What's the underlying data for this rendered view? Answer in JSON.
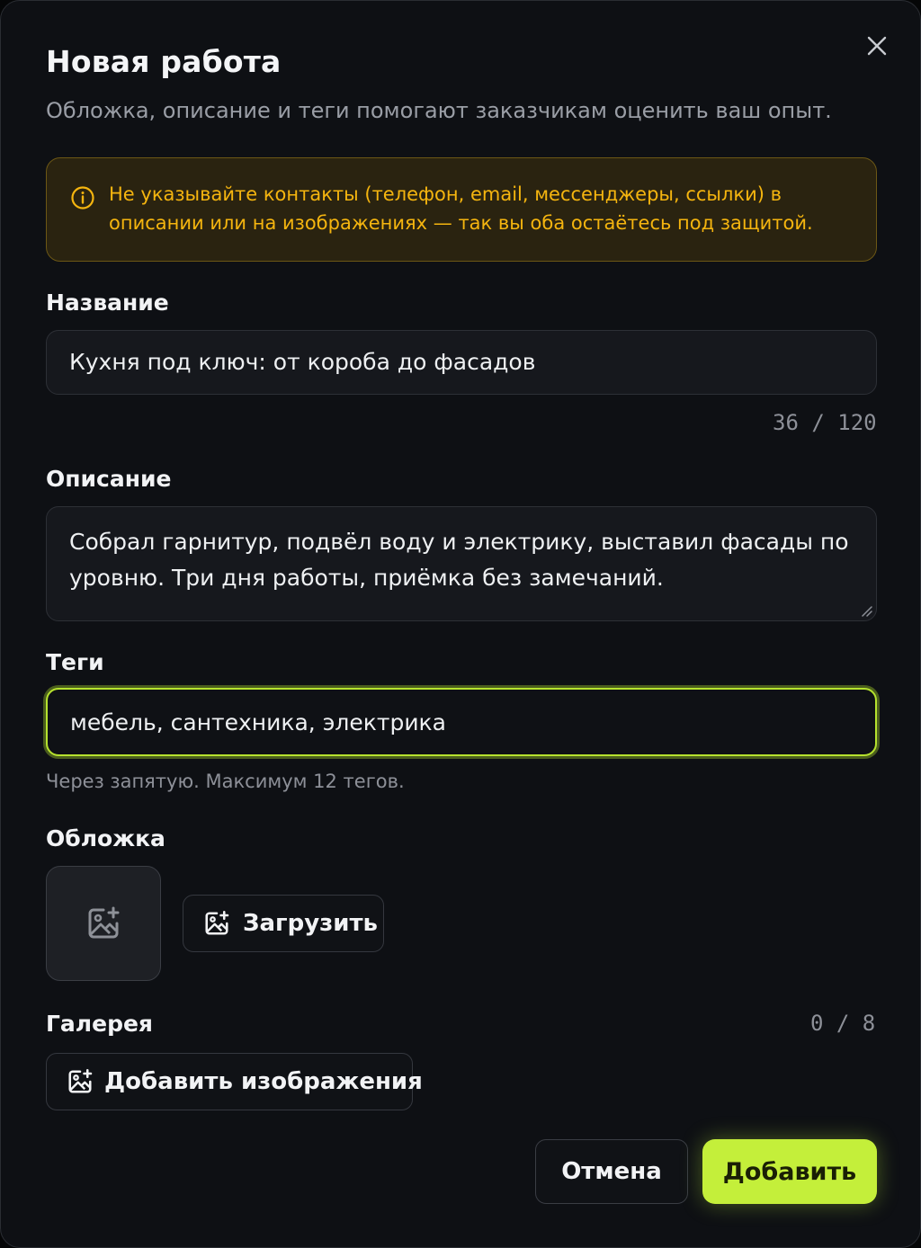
{
  "dialog": {
    "title": "Новая работа",
    "subtitle": "Обложка, описание и теги помогают заказчикам оценить ваш опыт.",
    "close_icon": "close-icon"
  },
  "warning": {
    "icon": "info-icon",
    "text": "Не указывайте контакты (телефон, email, мессенджеры, ссылки) в описании или на изображениях — так вы оба остаётесь под защитой.",
    "color": "#f5b50f"
  },
  "fields": {
    "name": {
      "label": "Название",
      "value": "Кухня под ключ: от короба до фасадов",
      "counter": "36 / 120"
    },
    "description": {
      "label": "Описание",
      "value": "Собрал гарнитур, подвёл воду и электрику, выставил фасады по уровню. Три дня работы, приёмка без замечаний."
    },
    "tags": {
      "label": "Теги",
      "value": "мебель, сантехника, электрика",
      "hint": "Через запятую. Максимум 12 тегов."
    }
  },
  "cover": {
    "label": "Обложка",
    "placeholder_icon": "image-plus-icon",
    "upload_label": "Загрузить"
  },
  "gallery": {
    "label": "Галерея",
    "counter": "0 / 8",
    "add_label": "Добавить изображения"
  },
  "actions": {
    "cancel_label": "Отмена",
    "submit_label": "Добавить"
  },
  "colors": {
    "accent": "#c4ef3a",
    "focus_ring": "#b6e22e",
    "warning_text": "#f5b50f",
    "background": "#0e1014"
  }
}
